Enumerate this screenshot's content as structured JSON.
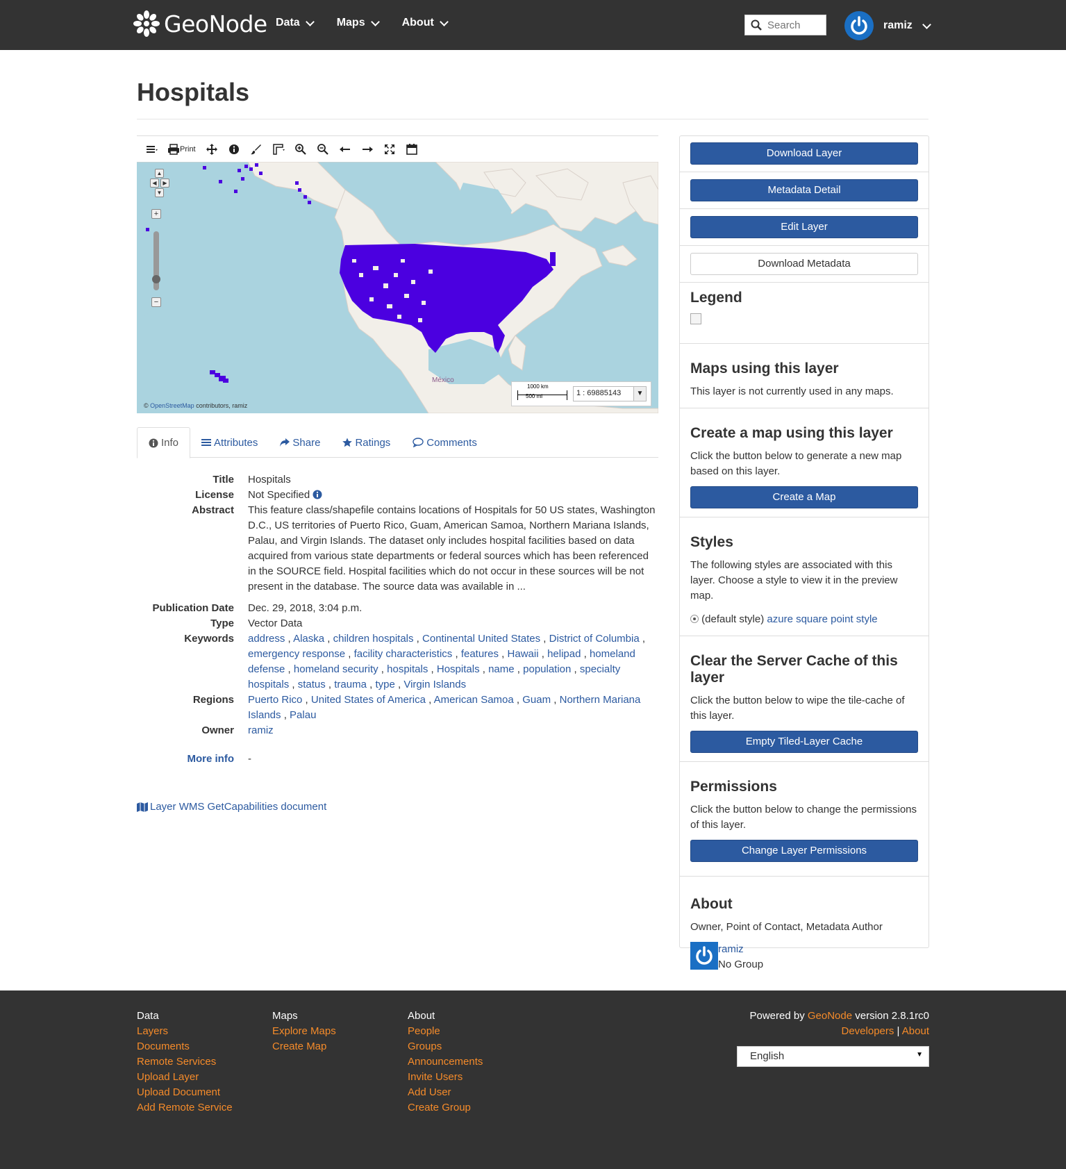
{
  "navbar": {
    "brand": "GeoNode",
    "menu": [
      "Data",
      "Maps",
      "About"
    ],
    "search_placeholder": "Search",
    "user": "ramiz"
  },
  "page": {
    "title": "Hospitals"
  },
  "map": {
    "toolbar": {
      "print_label": "Print"
    },
    "attribution_prefix": "©",
    "attribution_link": "OpenStreetMap",
    "attribution_suffix": "contributors, ramiz",
    "scale_km": "1000 km",
    "scale_mi": "500 mi",
    "scale_value": "1 : 69885143",
    "place_label": "México",
    "point_color": "#4b00e0"
  },
  "tabs": [
    "Info",
    "Attributes",
    "Share",
    "Ratings",
    "Comments"
  ],
  "info": {
    "title_label": "Title",
    "title_value": "Hospitals",
    "license_label": "License",
    "license_value": "Not Specified",
    "abstract_label": "Abstract",
    "abstract_value": "This feature class/shapefile contains locations of Hospitals for 50 US states, Washington D.C., US territories of Puerto Rico, Guam, American Samoa, Northern Mariana Islands, Palau, and Virgin Islands. The dataset only includes hospital facilities based on data acquired from various state departments or federal sources which has been referenced in the SOURCE field. Hospital facilities which do not occur in these sources will be not present in the database. The source data was available in ...",
    "pubdate_label": "Publication Date",
    "pubdate_value": "Dec. 29, 2018, 3:04 p.m.",
    "type_label": "Type",
    "type_value": "Vector Data",
    "keywords_label": "Keywords",
    "keywords": [
      "address",
      "Alaska",
      "children hospitals",
      "Continental United States",
      "District of Columbia",
      "emergency response",
      "facility characteristics",
      "features",
      "Hawaii",
      "helipad",
      "homeland defense",
      "homeland security",
      "hospitals",
      "Hospitals",
      "name",
      "population",
      "specialty hospitals",
      "status",
      "trauma",
      "type",
      "Virgin Islands"
    ],
    "regions_label": "Regions",
    "regions": [
      "Puerto Rico",
      "United States of America",
      "American Samoa",
      "Guam",
      "Northern Mariana Islands",
      "Palau"
    ],
    "owner_label": "Owner",
    "owner_value": "ramiz",
    "moreinfo_label": "More info",
    "moreinfo_value": "-",
    "wms_link": "Layer WMS GetCapabilities document"
  },
  "sidebar": {
    "download_layer": "Download Layer",
    "metadata_detail": "Metadata Detail",
    "edit_layer": "Edit Layer",
    "download_metadata": "Download Metadata",
    "legend_title": "Legend",
    "maps_title": "Maps using this layer",
    "maps_text": "This layer is not currently used in any maps.",
    "create_title": "Create a map using this layer",
    "create_text": "Click the button below to generate a new map based on this layer.",
    "create_button": "Create a Map",
    "styles_title": "Styles",
    "styles_text": "The following styles are associated with this layer. Choose a style to view it in the preview map.",
    "style_default": "(default style)",
    "style_name": "azure square point style",
    "cache_title": "Clear the Server Cache of this layer",
    "cache_text": "Click the button below to wipe the tile-cache of this layer.",
    "cache_button": "Empty Tiled-Layer Cache",
    "perm_title": "Permissions",
    "perm_text": "Click the button below to change the permissions of this layer.",
    "perm_button": "Change Layer Permissions",
    "about_title": "About",
    "about_roles": "Owner, Point of Contact, Metadata Author",
    "about_user": "ramiz",
    "about_group": "No Group"
  },
  "footer": {
    "col1": {
      "heading": "Data",
      "links": [
        "Layers",
        "Documents",
        "Remote Services",
        "Upload Layer",
        "Upload Document",
        "Add Remote Service"
      ]
    },
    "col2": {
      "heading": "Maps",
      "links": [
        "Explore Maps",
        "Create Map"
      ]
    },
    "col3": {
      "heading": "About",
      "links": [
        "People",
        "Groups",
        "Announcements",
        "Invite Users",
        "Add User",
        "Create Group"
      ]
    },
    "powered_prefix": "Powered by",
    "powered_link": "GeoNode",
    "powered_suffix": "version 2.8.1rc0",
    "developers": "Developers",
    "separator": "|",
    "about": "About",
    "language": "English"
  }
}
